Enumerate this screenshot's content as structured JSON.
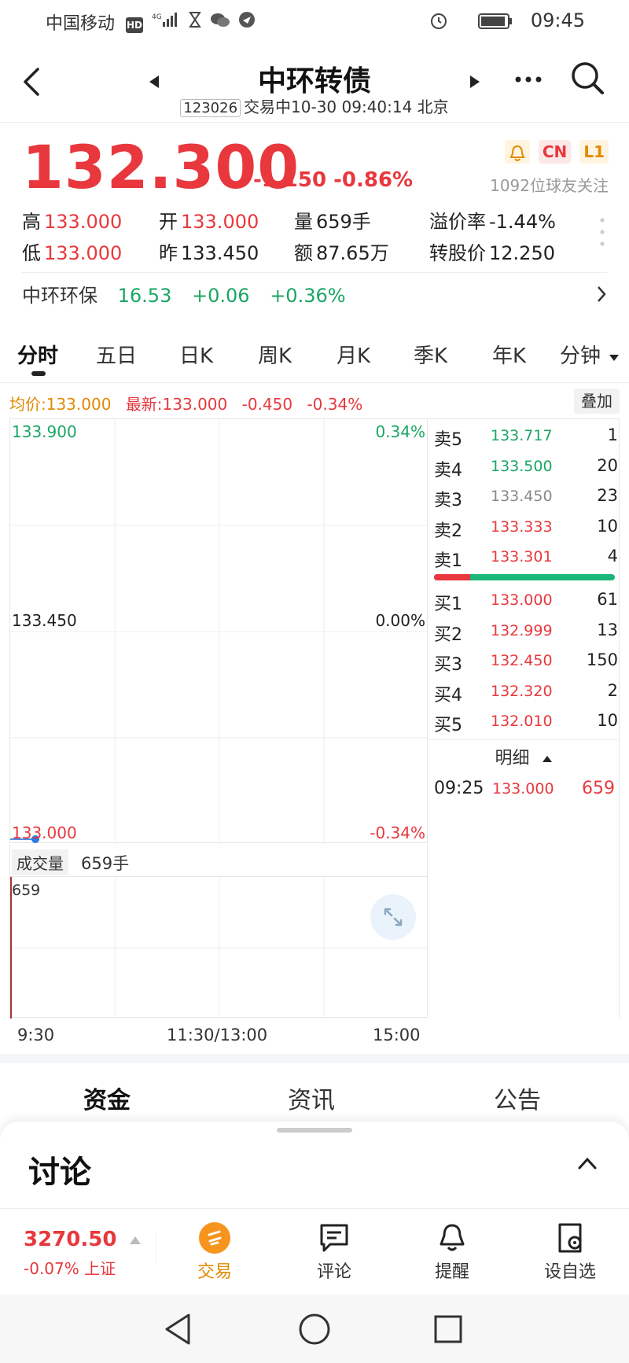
{
  "status": {
    "carrier": "中国移动",
    "network": "4G",
    "time": "09:45"
  },
  "header": {
    "title": "中环转债",
    "code": "123026",
    "sub": "交易中10-30 09:40:14 北京"
  },
  "quote": {
    "price": "132.300",
    "change": "-1.150",
    "change_pct": "-0.86%",
    "tags": [
      "CN",
      "L1"
    ],
    "followers": "1092位球友关注",
    "stats": [
      {
        "label": "高",
        "value": "133.000",
        "color": "red"
      },
      {
        "label": "开",
        "value": "133.000",
        "color": "red"
      },
      {
        "label": "量",
        "value": "659手",
        "color": "dark"
      },
      {
        "label": "溢价率",
        "value": "-1.44%",
        "color": "dark"
      },
      {
        "label": "低",
        "value": "133.000",
        "color": "red"
      },
      {
        "label": "昨",
        "value": "133.450",
        "color": "dark"
      },
      {
        "label": "额",
        "value": "87.65万",
        "color": "dark"
      },
      {
        "label": "转股价",
        "value": "12.250",
        "color": "dark"
      }
    ]
  },
  "related": {
    "name": "中环环保",
    "price": "16.53",
    "change": "+0.06",
    "pct": "+0.36%"
  },
  "tabs": [
    "分时",
    "五日",
    "日K",
    "周K",
    "月K",
    "季K",
    "年K",
    "分钟"
  ],
  "chart": {
    "avg": "均价:133.000",
    "latest": "最新:133.000",
    "chg": "-0.450",
    "pct": "-0.34%",
    "overlay": "叠加",
    "y_top": "133.900",
    "y_mid": "133.450",
    "y_bot": "133.000",
    "pct_top": "0.34%",
    "pct_mid": "0.00%",
    "pct_bot": "-0.34%",
    "vol_label": "成交量",
    "vol_value": "659手",
    "vol_max": "659",
    "x_labels": [
      "9:30",
      "11:30/13:00",
      "15:00"
    ]
  },
  "orderbook": {
    "asks": [
      {
        "name": "卖5",
        "price": "133.717",
        "vol": "1",
        "color": "green"
      },
      {
        "name": "卖4",
        "price": "133.500",
        "vol": "20",
        "color": "green"
      },
      {
        "name": "卖3",
        "price": "133.450",
        "vol": "23",
        "color": "gray"
      },
      {
        "name": "卖2",
        "price": "133.333",
        "vol": "10",
        "color": "red"
      },
      {
        "name": "卖1",
        "price": "133.301",
        "vol": "4",
        "color": "red"
      }
    ],
    "bids": [
      {
        "name": "买1",
        "price": "133.000",
        "vol": "61",
        "color": "red"
      },
      {
        "name": "买2",
        "price": "132.999",
        "vol": "13",
        "color": "red"
      },
      {
        "name": "买3",
        "price": "132.450",
        "vol": "150",
        "color": "red"
      },
      {
        "name": "买4",
        "price": "132.320",
        "vol": "2",
        "color": "red"
      },
      {
        "name": "买5",
        "price": "132.010",
        "vol": "10",
        "color": "red"
      }
    ],
    "detail_label": "明细",
    "ticks": [
      {
        "time": "09:25",
        "price": "133.000",
        "vol": "659"
      }
    ]
  },
  "sections": [
    "资金",
    "资讯",
    "公告"
  ],
  "sheet": {
    "title": "讨论"
  },
  "index": {
    "value": "3270.50",
    "change": "-0.07%",
    "name": "上证"
  },
  "bottombar": [
    "交易",
    "评论",
    "提醒",
    "设自选"
  ]
}
